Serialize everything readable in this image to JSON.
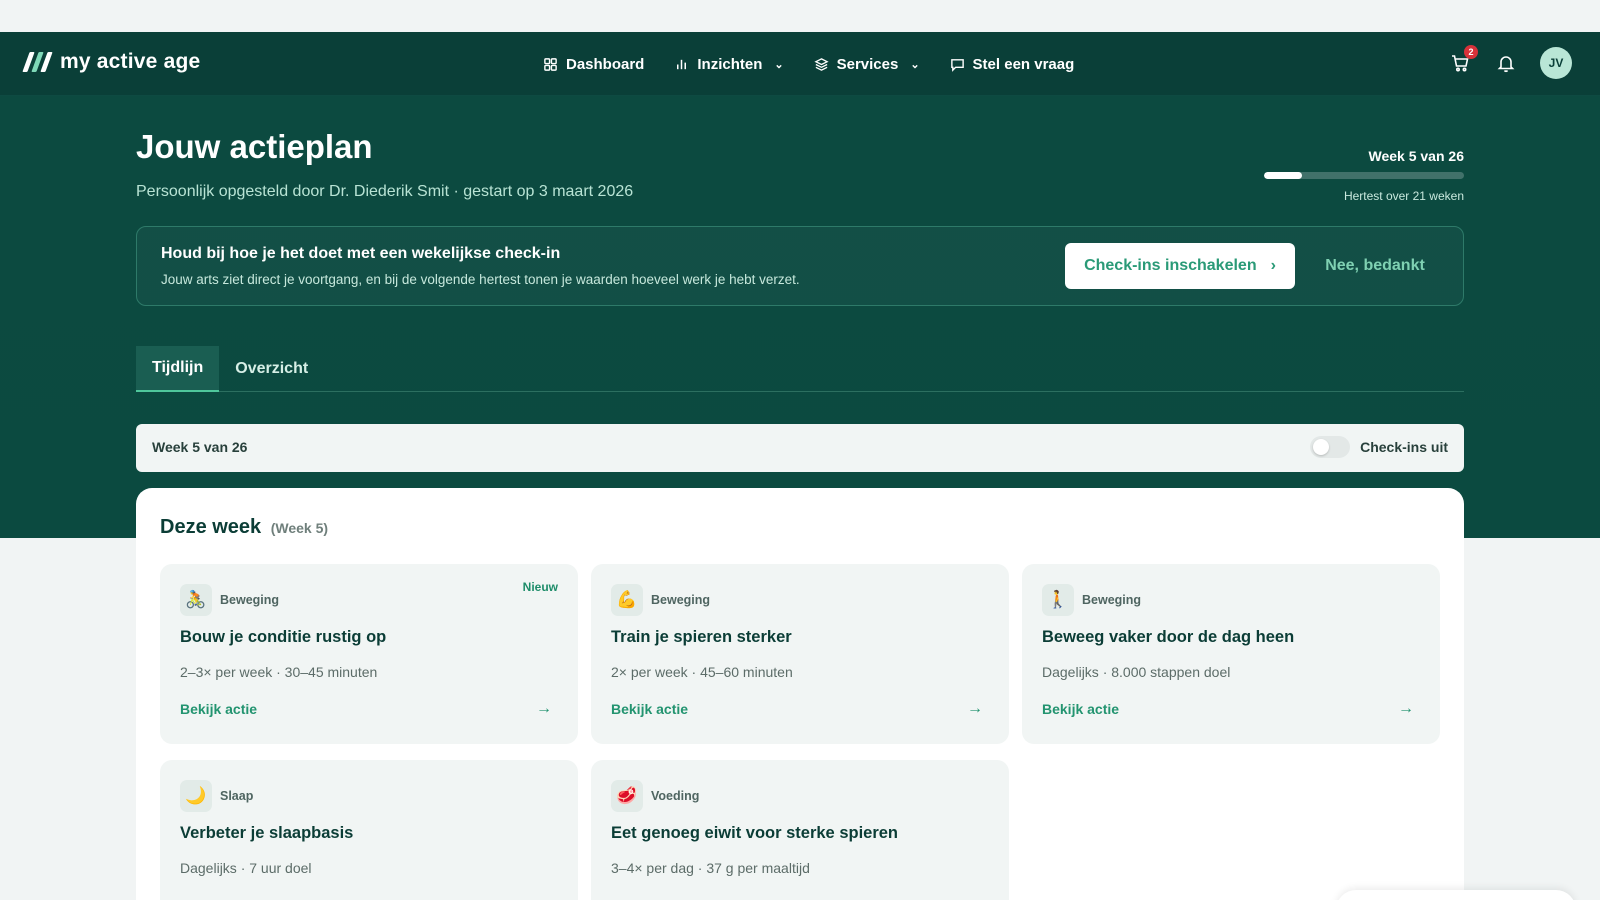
{
  "brand": {
    "name": "my active age"
  },
  "nav": {
    "items": [
      {
        "label": "Dashboard",
        "icon": "grid-icon",
        "dropdown": false
      },
      {
        "label": "Inzichten",
        "icon": "bar-chart-icon",
        "dropdown": true
      },
      {
        "label": "Services",
        "icon": "layers-icon",
        "dropdown": true
      },
      {
        "label": "Stel een vraag",
        "icon": "chat-icon",
        "dropdown": false
      }
    ]
  },
  "header": {
    "cart_count": "2",
    "avatar_initials": "JV"
  },
  "page": {
    "title": "Jouw actieplan",
    "subtitle": "Persoonlijk opgesteld door Dr. Diederik Smit · gestart op 3 maart 2026"
  },
  "progress": {
    "label": "Week 5 van 26",
    "current_week": 5,
    "total_weeks": 26,
    "note": "Hertest over 21 weken"
  },
  "banner": {
    "title": "Houd bij hoe je het doet met een wekelijkse check-in",
    "text": "Jouw arts ziet direct je voortgang, en bij de volgende hertest tonen je waarden hoeveel werk je hebt verzet.",
    "primary_label": "Check-ins inschakelen",
    "secondary_label": "Nee, bedankt"
  },
  "tabs": [
    {
      "label": "Tijdlijn",
      "active": true
    },
    {
      "label": "Overzicht",
      "active": false
    }
  ],
  "weekbar": {
    "label": "Week 5 van 26",
    "toggle_label": "Check-ins uit",
    "toggle_on": false
  },
  "section": {
    "title": "Deze week",
    "subtitle": "(Week 5)"
  },
  "cards": [
    {
      "category": "Beweging",
      "emoji": "🚴",
      "icon": "bicycle-icon",
      "badge": "Nieuw",
      "title": "Bouw je conditie rustig op",
      "meta": "2–3× per week · 30–45 minuten",
      "link": "Bekijk actie"
    },
    {
      "category": "Beweging",
      "emoji": "💪",
      "icon": "muscle-icon",
      "badge": "",
      "title": "Train je spieren sterker",
      "meta": "2× per week · 45–60 minuten",
      "link": "Bekijk actie"
    },
    {
      "category": "Beweging",
      "emoji": "🚶",
      "icon": "walking-icon",
      "badge": "",
      "title": "Beweeg vaker door de dag heen",
      "meta": "Dagelijks · 8.000 stappen doel",
      "link": "Bekijk actie"
    },
    {
      "category": "Slaap",
      "emoji": "🌙",
      "icon": "moon-icon",
      "badge": "",
      "title": "Verbeter je slaapbasis",
      "meta": "Dagelijks · 7 uur doel",
      "link": ""
    },
    {
      "category": "Voeding",
      "emoji": "🥩",
      "icon": "meat-icon",
      "badge": "",
      "title": "Eet genoeg eiwit voor sterke spieren",
      "meta": "3–4× per dag · 37 g per maaltijd",
      "link": ""
    }
  ],
  "colors": {
    "header_bg": "#0a3f38",
    "hero_bg": "#0c4a40",
    "accent": "#239470",
    "badge_red": "#d8323a"
  }
}
